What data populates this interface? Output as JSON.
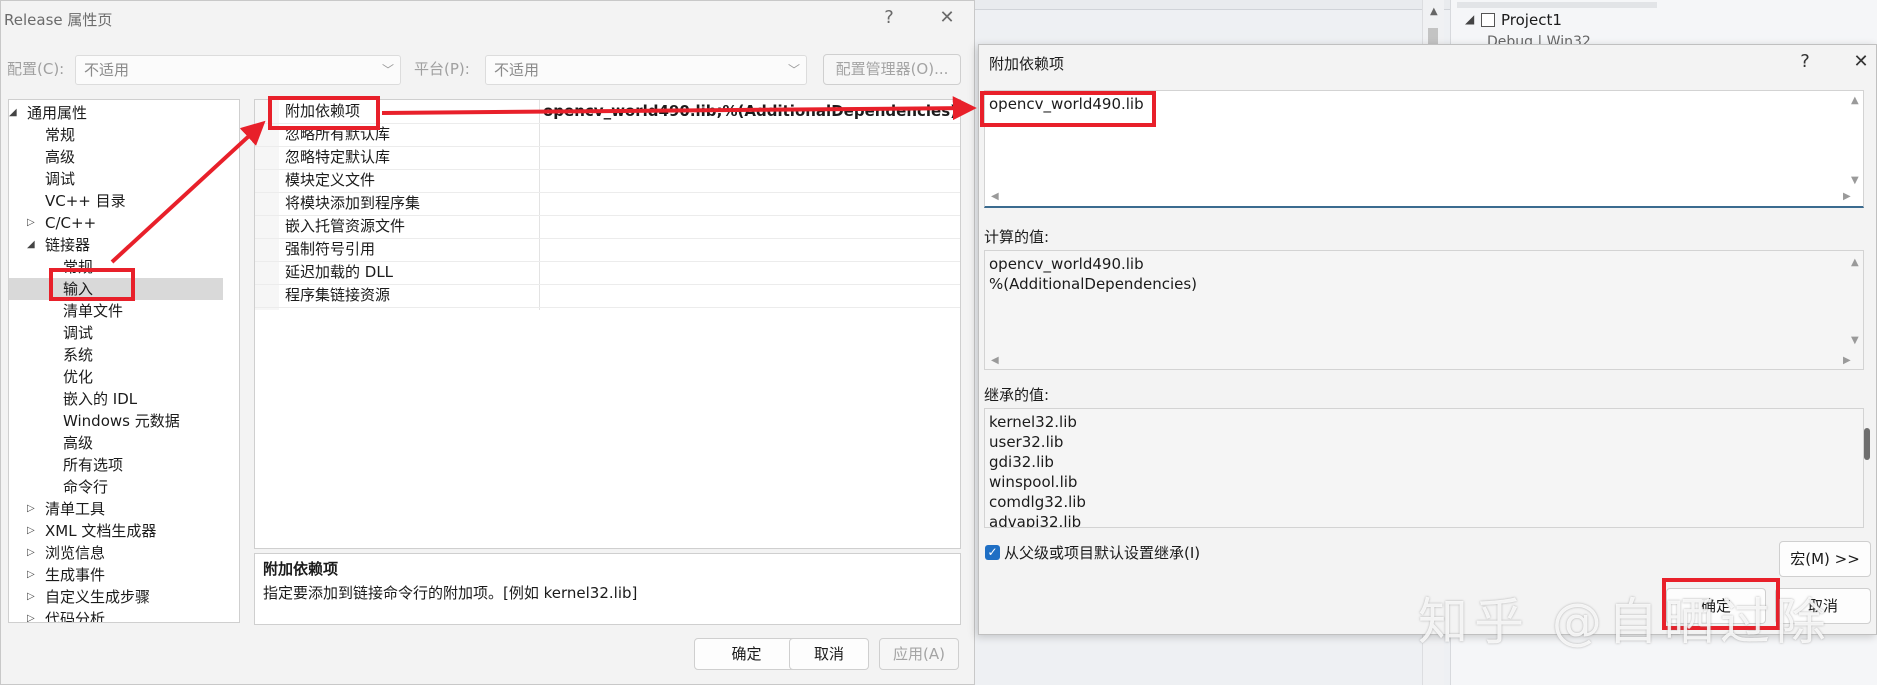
{
  "ide": {
    "solution_project": "Project1",
    "solution_sub": "Debug | Win32"
  },
  "main_dialog": {
    "title": "Release 属性页",
    "help": "?",
    "close": "✕",
    "config_label": "配置(C):",
    "config_value": "不适用",
    "platform_label": "平台(P):",
    "platform_value": "不适用",
    "config_manager": "配置管理器(O)...",
    "tree": [
      {
        "label": "通用属性",
        "level": 0,
        "exp": "◢"
      },
      {
        "label": "常规",
        "level": 1,
        "exp": ""
      },
      {
        "label": "高级",
        "level": 1,
        "exp": ""
      },
      {
        "label": "调试",
        "level": 1,
        "exp": ""
      },
      {
        "label": "VC++ 目录",
        "level": 1,
        "exp": ""
      },
      {
        "label": "C/C++",
        "level": 1,
        "exp": "▷"
      },
      {
        "label": "链接器",
        "level": 1,
        "exp": "◢"
      },
      {
        "label": "常规",
        "level": 2,
        "exp": ""
      },
      {
        "label": "输入",
        "level": 2,
        "exp": "",
        "selected": true
      },
      {
        "label": "清单文件",
        "level": 2,
        "exp": ""
      },
      {
        "label": "调试",
        "level": 2,
        "exp": ""
      },
      {
        "label": "系统",
        "level": 2,
        "exp": ""
      },
      {
        "label": "优化",
        "level": 2,
        "exp": ""
      },
      {
        "label": "嵌入的 IDL",
        "level": 2,
        "exp": ""
      },
      {
        "label": "Windows 元数据",
        "level": 2,
        "exp": ""
      },
      {
        "label": "高级",
        "level": 2,
        "exp": ""
      },
      {
        "label": "所有选项",
        "level": 2,
        "exp": ""
      },
      {
        "label": "命令行",
        "level": 2,
        "exp": ""
      },
      {
        "label": "清单工具",
        "level": 1,
        "exp": "▷"
      },
      {
        "label": "XML 文档生成器",
        "level": 1,
        "exp": "▷"
      },
      {
        "label": "浏览信息",
        "level": 1,
        "exp": "▷"
      },
      {
        "label": "生成事件",
        "level": 1,
        "exp": "▷"
      },
      {
        "label": "自定义生成步骤",
        "level": 1,
        "exp": "▷"
      },
      {
        "label": "代码分析",
        "level": 1,
        "exp": "▷"
      }
    ],
    "properties": [
      {
        "name": "附加依赖项",
        "value": "opencv_world490.lib;%(AdditionalDependencies)"
      },
      {
        "name": "忽略所有默认库",
        "value": ""
      },
      {
        "name": "忽略特定默认库",
        "value": ""
      },
      {
        "name": "模块定义文件",
        "value": ""
      },
      {
        "name": "将模块添加到程序集",
        "value": ""
      },
      {
        "name": "嵌入托管资源文件",
        "value": ""
      },
      {
        "name": "强制符号引用",
        "value": ""
      },
      {
        "name": "延迟加载的 DLL",
        "value": ""
      },
      {
        "name": "程序集链接资源",
        "value": ""
      }
    ],
    "desc_title": "附加依赖项",
    "desc_text": "指定要添加到链接命令行的附加项。[例如 kernel32.lib]",
    "ok": "确定",
    "cancel": "取消",
    "apply": "应用(A)"
  },
  "dep_dialog": {
    "title": "附加依赖项",
    "help": "?",
    "close": "✕",
    "edit_value": "opencv_world490.lib",
    "computed_label": "计算的值:",
    "computed_lines": [
      "opencv_world490.lib",
      "%(AdditionalDependencies)"
    ],
    "inherited_label": "继承的值:",
    "inherited_lines": [
      "kernel32.lib",
      "user32.lib",
      "gdi32.lib",
      "winspool.lib",
      "comdlg32.lib",
      "advapi32.lib"
    ],
    "inherit_checkbox": "从父级或项目默认设置继承(I)",
    "macro_button": "宏(M) >>",
    "ok": "确定",
    "cancel": "取消"
  },
  "watermark": "知乎 @自晒过除",
  "colors": {
    "highlight": "#e8202a",
    "accent": "#1f6fc4"
  }
}
